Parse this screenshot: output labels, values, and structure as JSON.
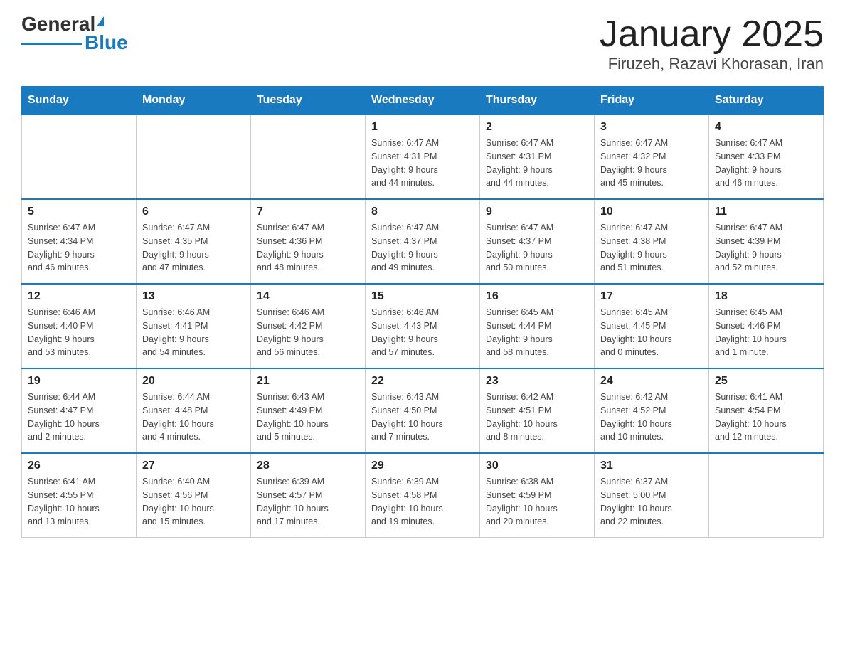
{
  "header": {
    "logo_general": "General",
    "logo_blue": "Blue",
    "title": "January 2025",
    "subtitle": "Firuzeh, Razavi Khorasan, Iran"
  },
  "weekdays": [
    "Sunday",
    "Monday",
    "Tuesday",
    "Wednesday",
    "Thursday",
    "Friday",
    "Saturday"
  ],
  "weeks": [
    [
      {
        "day": "",
        "info": ""
      },
      {
        "day": "",
        "info": ""
      },
      {
        "day": "",
        "info": ""
      },
      {
        "day": "1",
        "info": "Sunrise: 6:47 AM\nSunset: 4:31 PM\nDaylight: 9 hours\nand 44 minutes."
      },
      {
        "day": "2",
        "info": "Sunrise: 6:47 AM\nSunset: 4:31 PM\nDaylight: 9 hours\nand 44 minutes."
      },
      {
        "day": "3",
        "info": "Sunrise: 6:47 AM\nSunset: 4:32 PM\nDaylight: 9 hours\nand 45 minutes."
      },
      {
        "day": "4",
        "info": "Sunrise: 6:47 AM\nSunset: 4:33 PM\nDaylight: 9 hours\nand 46 minutes."
      }
    ],
    [
      {
        "day": "5",
        "info": "Sunrise: 6:47 AM\nSunset: 4:34 PM\nDaylight: 9 hours\nand 46 minutes."
      },
      {
        "day": "6",
        "info": "Sunrise: 6:47 AM\nSunset: 4:35 PM\nDaylight: 9 hours\nand 47 minutes."
      },
      {
        "day": "7",
        "info": "Sunrise: 6:47 AM\nSunset: 4:36 PM\nDaylight: 9 hours\nand 48 minutes."
      },
      {
        "day": "8",
        "info": "Sunrise: 6:47 AM\nSunset: 4:37 PM\nDaylight: 9 hours\nand 49 minutes."
      },
      {
        "day": "9",
        "info": "Sunrise: 6:47 AM\nSunset: 4:37 PM\nDaylight: 9 hours\nand 50 minutes."
      },
      {
        "day": "10",
        "info": "Sunrise: 6:47 AM\nSunset: 4:38 PM\nDaylight: 9 hours\nand 51 minutes."
      },
      {
        "day": "11",
        "info": "Sunrise: 6:47 AM\nSunset: 4:39 PM\nDaylight: 9 hours\nand 52 minutes."
      }
    ],
    [
      {
        "day": "12",
        "info": "Sunrise: 6:46 AM\nSunset: 4:40 PM\nDaylight: 9 hours\nand 53 minutes."
      },
      {
        "day": "13",
        "info": "Sunrise: 6:46 AM\nSunset: 4:41 PM\nDaylight: 9 hours\nand 54 minutes."
      },
      {
        "day": "14",
        "info": "Sunrise: 6:46 AM\nSunset: 4:42 PM\nDaylight: 9 hours\nand 56 minutes."
      },
      {
        "day": "15",
        "info": "Sunrise: 6:46 AM\nSunset: 4:43 PM\nDaylight: 9 hours\nand 57 minutes."
      },
      {
        "day": "16",
        "info": "Sunrise: 6:45 AM\nSunset: 4:44 PM\nDaylight: 9 hours\nand 58 minutes."
      },
      {
        "day": "17",
        "info": "Sunrise: 6:45 AM\nSunset: 4:45 PM\nDaylight: 10 hours\nand 0 minutes."
      },
      {
        "day": "18",
        "info": "Sunrise: 6:45 AM\nSunset: 4:46 PM\nDaylight: 10 hours\nand 1 minute."
      }
    ],
    [
      {
        "day": "19",
        "info": "Sunrise: 6:44 AM\nSunset: 4:47 PM\nDaylight: 10 hours\nand 2 minutes."
      },
      {
        "day": "20",
        "info": "Sunrise: 6:44 AM\nSunset: 4:48 PM\nDaylight: 10 hours\nand 4 minutes."
      },
      {
        "day": "21",
        "info": "Sunrise: 6:43 AM\nSunset: 4:49 PM\nDaylight: 10 hours\nand 5 minutes."
      },
      {
        "day": "22",
        "info": "Sunrise: 6:43 AM\nSunset: 4:50 PM\nDaylight: 10 hours\nand 7 minutes."
      },
      {
        "day": "23",
        "info": "Sunrise: 6:42 AM\nSunset: 4:51 PM\nDaylight: 10 hours\nand 8 minutes."
      },
      {
        "day": "24",
        "info": "Sunrise: 6:42 AM\nSunset: 4:52 PM\nDaylight: 10 hours\nand 10 minutes."
      },
      {
        "day": "25",
        "info": "Sunrise: 6:41 AM\nSunset: 4:54 PM\nDaylight: 10 hours\nand 12 minutes."
      }
    ],
    [
      {
        "day": "26",
        "info": "Sunrise: 6:41 AM\nSunset: 4:55 PM\nDaylight: 10 hours\nand 13 minutes."
      },
      {
        "day": "27",
        "info": "Sunrise: 6:40 AM\nSunset: 4:56 PM\nDaylight: 10 hours\nand 15 minutes."
      },
      {
        "day": "28",
        "info": "Sunrise: 6:39 AM\nSunset: 4:57 PM\nDaylight: 10 hours\nand 17 minutes."
      },
      {
        "day": "29",
        "info": "Sunrise: 6:39 AM\nSunset: 4:58 PM\nDaylight: 10 hours\nand 19 minutes."
      },
      {
        "day": "30",
        "info": "Sunrise: 6:38 AM\nSunset: 4:59 PM\nDaylight: 10 hours\nand 20 minutes."
      },
      {
        "day": "31",
        "info": "Sunrise: 6:37 AM\nSunset: 5:00 PM\nDaylight: 10 hours\nand 22 minutes."
      },
      {
        "day": "",
        "info": ""
      }
    ]
  ]
}
